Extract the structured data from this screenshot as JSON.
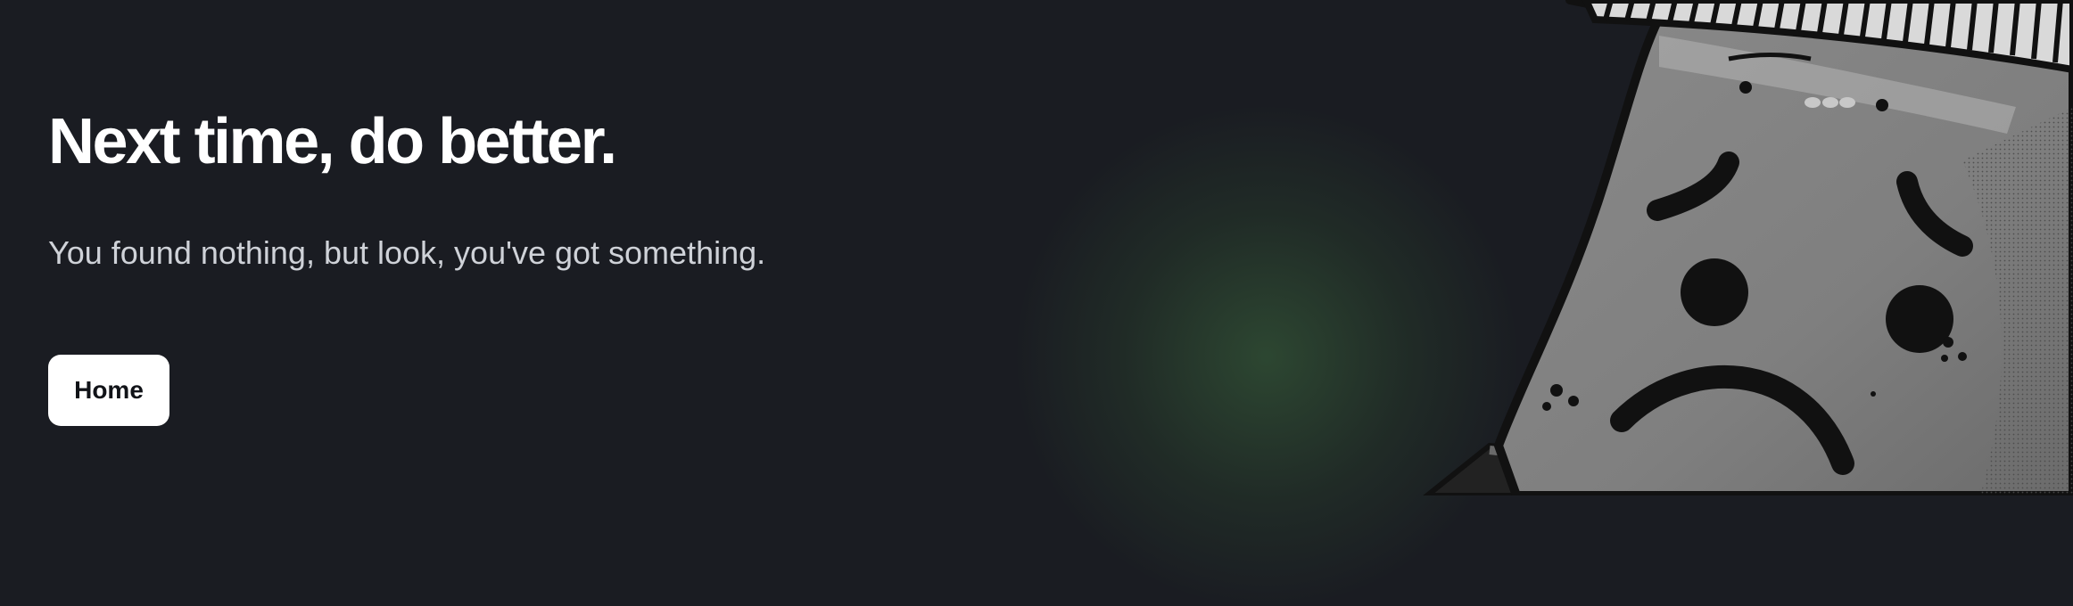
{
  "page": {
    "headline": "Next time, do better.",
    "subtitle": "You found nothing, but look, you've got something.",
    "home_button_label": "Home"
  },
  "illustration": {
    "icon": "sad-face-mascot-icon"
  },
  "colors": {
    "background": "#1a1c22",
    "headline": "#ffffff",
    "subtitle": "#cfd2d8",
    "button_background": "#ffffff",
    "button_text": "#111318",
    "glow": "#304e34",
    "mascot_fill": "#8e8e8e",
    "mascot_outline": "#111111"
  }
}
